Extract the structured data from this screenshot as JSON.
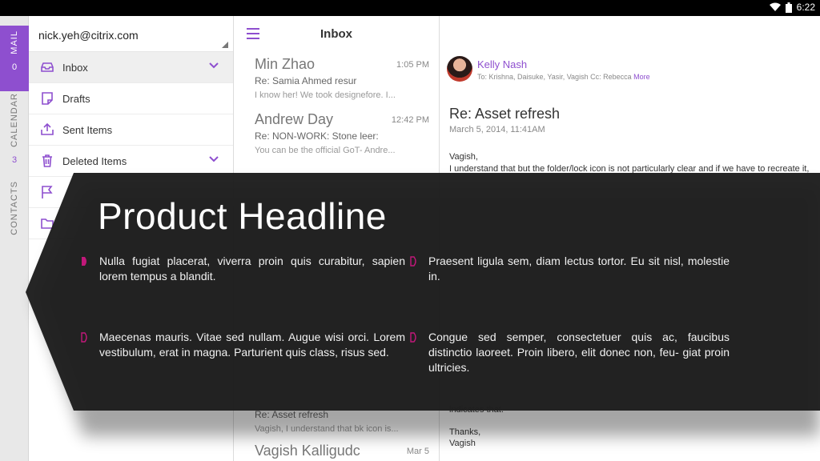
{
  "status_bar": {
    "time": "6:22"
  },
  "rail": {
    "mail_label": "MAIL",
    "mail_count": "0",
    "calendar_label": "CALENDAR",
    "calendar_count": "3",
    "contacts_label": "CONTACTS"
  },
  "account": {
    "email": "nick.yeh@citrix.com"
  },
  "folders": {
    "items": [
      {
        "label": "Inbox",
        "icon": "inbox-icon"
      },
      {
        "label": "Drafts",
        "icon": "drafts-icon"
      },
      {
        "label": "Sent Items",
        "icon": "sent-items-icon"
      },
      {
        "label": "Deleted Items",
        "icon": "trash-icon"
      }
    ]
  },
  "list": {
    "title": "Inbox",
    "messages": [
      {
        "sender": "Min Zhao",
        "time": "1:05 PM",
        "subject": "Re: Samia Ahmed resur",
        "preview": "I know her! We took designefore. I..."
      },
      {
        "sender": "Andrew Day",
        "time": "12:42 PM",
        "subject": "Re: NON-WORK: Stone leer:",
        "preview": "You can be the official GoT- Andre..."
      },
      {
        "sender": "",
        "time": "",
        "subject": "Re: Asset refresh",
        "preview": "Vagish, I understand that bk icon is..."
      },
      {
        "sender": "Vagish Kalligudc",
        "time": "Mar 5",
        "subject": "",
        "preview": ""
      }
    ]
  },
  "reader": {
    "sender": "Kelly Nash",
    "recipients": "To: Krishna, Daisuke, Yasir, Vagish  Cc: Rebecca",
    "more_label": "More",
    "subject": "Re: Asset refresh",
    "date": "March 5, 2014, 11:41AM",
    "greeting": "Vagish,",
    "line1": "I understand that but the folder/lock icon is not particularly clear and if we have to recreate it,",
    "closing_line": "indicates that.",
    "thanks": "Thanks,",
    "signature": "Vagish"
  },
  "overlay": {
    "headline": "Product Headline",
    "bullets": [
      "Nulla fugiat placerat, viverra proin quis curabitur, sapien lorem tempus a blandit.",
      "Praesent ligula sem, diam lectus tortor. Eu sit nisl, molestie in.",
      "Maecenas mauris. Vitae sed nullam. Augue wisi orci. Lorem vestibulum, erat in magna. Parturient quis class, risus sed.",
      "Congue sed semper, consectetuer quis ac, faucibus distinctio laoreet. Proin libero, elit donec non, feu- giat proin ultricies."
    ]
  },
  "colors": {
    "accent": "#8e4fcf",
    "overlay": "#1e1e1e",
    "bullet_accent": "#c2187a"
  }
}
